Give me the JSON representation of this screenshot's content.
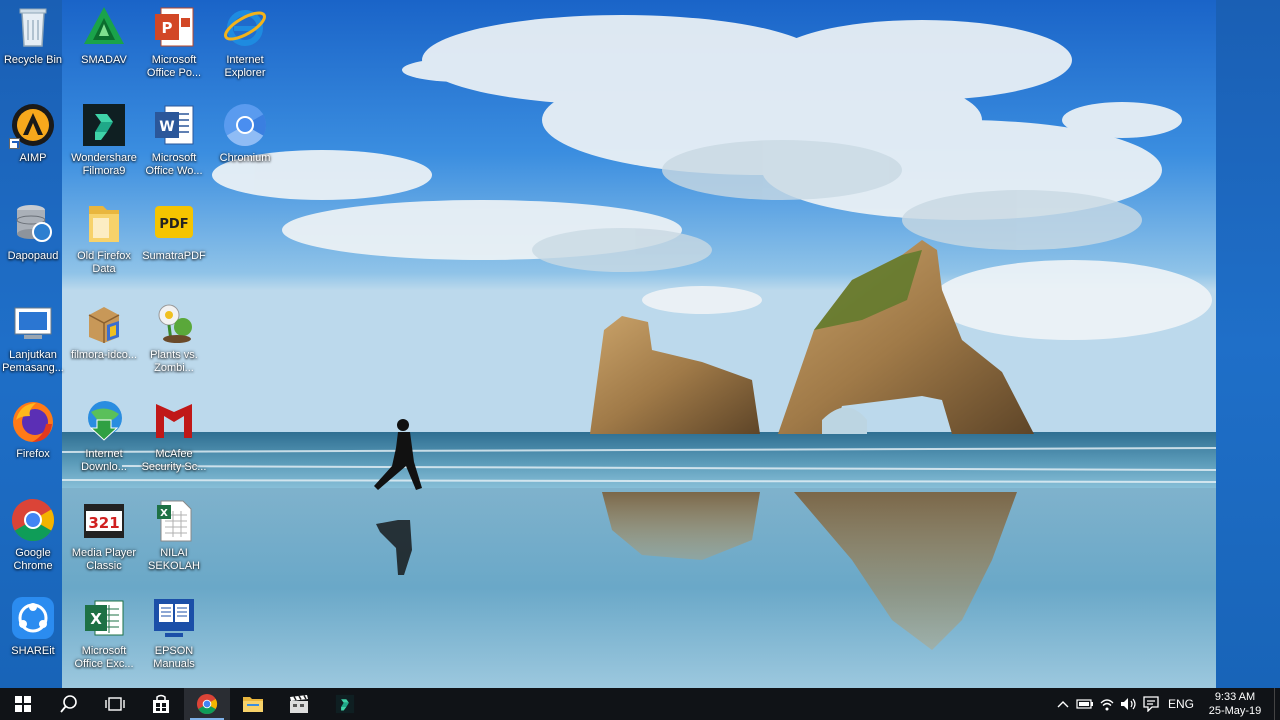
{
  "desktop_icons": {
    "col1": [
      {
        "label": "Recycle Bin",
        "icon": "recycle-bin-icon"
      },
      {
        "label": "AIMP",
        "icon": "aimp-icon"
      },
      {
        "label": "Dapopaud",
        "icon": "database-icon"
      },
      {
        "label": "Lanjutkan\nPemasang...",
        "icon": "installer-icon"
      },
      {
        "label": "Firefox",
        "icon": "firefox-icon"
      },
      {
        "label": "Google\nChrome",
        "icon": "chrome-icon"
      },
      {
        "label": "SHAREit",
        "icon": "shareit-icon"
      }
    ],
    "col2": [
      {
        "label": "SMADAV",
        "icon": "smadav-icon"
      },
      {
        "label": "Wondershare\nFilmora9",
        "icon": "filmora-icon"
      },
      {
        "label": "Old Firefox\nData",
        "icon": "folder-icon"
      },
      {
        "label": "filmora-idco...",
        "icon": "installer-box-icon"
      },
      {
        "label": "Internet\nDownlo...",
        "icon": "idm-icon"
      },
      {
        "label": "Media Player\nClassic",
        "icon": "media-player-icon"
      },
      {
        "label": "Microsoft\nOffice Exc...",
        "icon": "excel-icon"
      }
    ],
    "col3": [
      {
        "label": "Microsoft\nOffice Po...",
        "icon": "powerpoint-icon"
      },
      {
        "label": "Microsoft\nOffice Wo...",
        "icon": "word-icon"
      },
      {
        "label": "SumatraPDF",
        "icon": "pdf-icon"
      },
      {
        "label": "Plants vs.\nZombi...",
        "icon": "plants-icon"
      },
      {
        "label": "McAfee\nSecurity Sc...",
        "icon": "mcafee-icon"
      },
      {
        "label": "NILAI\nSEKOLAH",
        "icon": "spreadsheet-file-icon"
      },
      {
        "label": "EPSON\nManuals",
        "icon": "epson-icon"
      }
    ],
    "col4": [
      {
        "label": "Internet\nExplorer",
        "icon": "ie-icon"
      },
      {
        "label": "Chromium",
        "icon": "chromium-icon"
      }
    ]
  },
  "taskbar": {
    "buttons": [
      {
        "name": "start-button",
        "icon": "windows-logo-icon"
      },
      {
        "name": "search-button",
        "icon": "search-icon"
      },
      {
        "name": "task-view-button",
        "icon": "task-view-icon"
      },
      {
        "name": "store-button",
        "icon": "store-icon"
      },
      {
        "name": "chrome-taskbar-button",
        "icon": "chrome-icon"
      },
      {
        "name": "file-explorer-button",
        "icon": "folder-icon"
      },
      {
        "name": "media-app-button",
        "icon": "clapper-icon"
      },
      {
        "name": "filmora-taskbar-button",
        "icon": "filmora-icon"
      }
    ],
    "tray": {
      "language": "ENG",
      "time": "9:33 AM",
      "date": "25-May-19"
    }
  },
  "colors": {
    "taskbar_bg": "#101317",
    "desktop_side": "#1a5fb4",
    "sky_top": "#1e6fd0",
    "sea": "#5fa6c8"
  }
}
